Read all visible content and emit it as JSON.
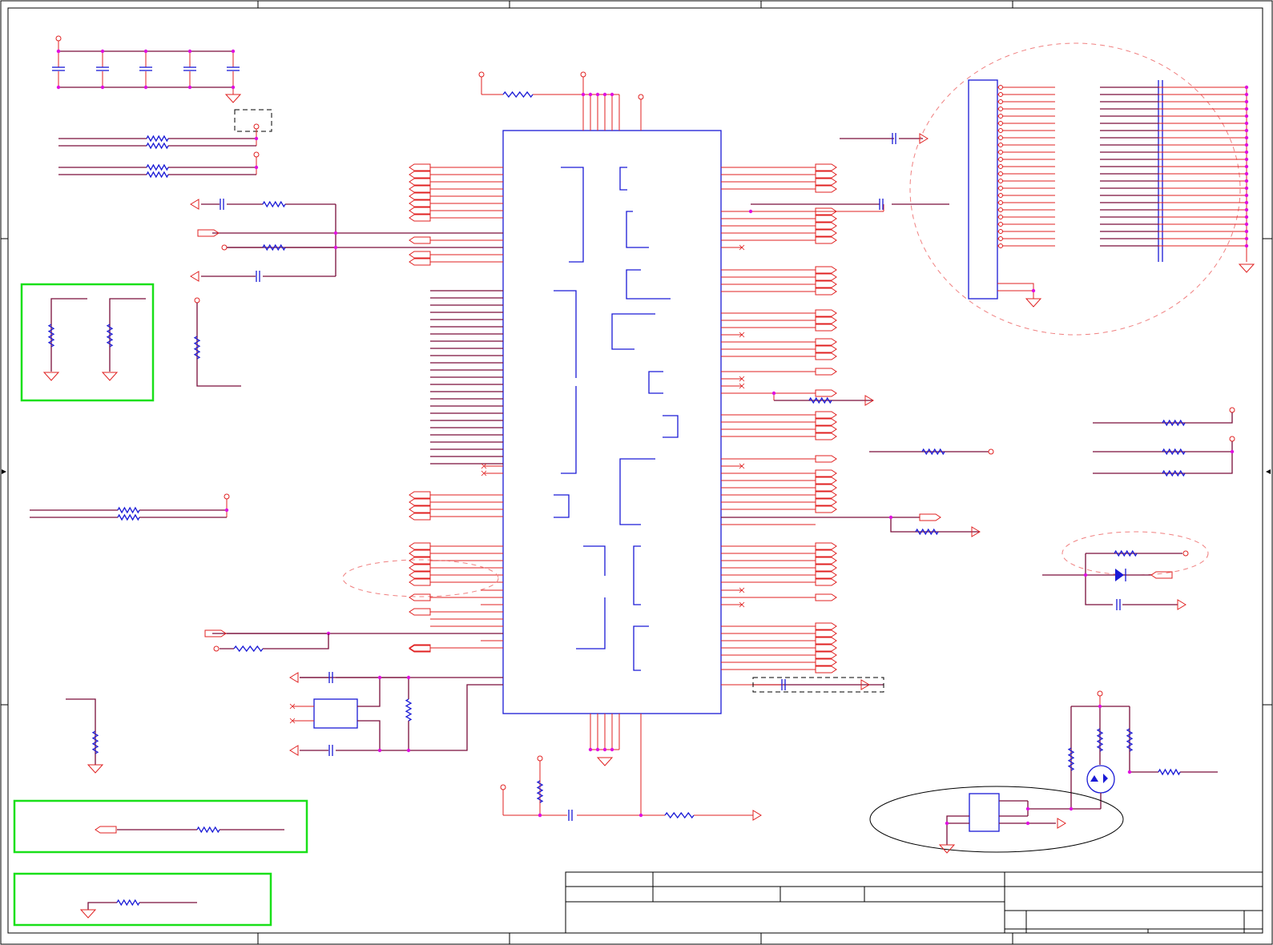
{
  "app": {
    "type": "schematic-sheet",
    "frame_color": "#000000"
  },
  "colors": {
    "wire": "#e02020",
    "net": "#7a0e3a",
    "component_body": "#1a1ad6",
    "junction": "#e010e0",
    "highlight_box": "#19e019",
    "annotation_circle": "#f08080"
  },
  "title_block": {
    "cells": []
  },
  "icons": [
    "ground-icon",
    "power-port-icon",
    "resistor-icon",
    "capacitor-icon",
    "diode-icon",
    "mosfet-icon",
    "offpage-connector-icon"
  ]
}
